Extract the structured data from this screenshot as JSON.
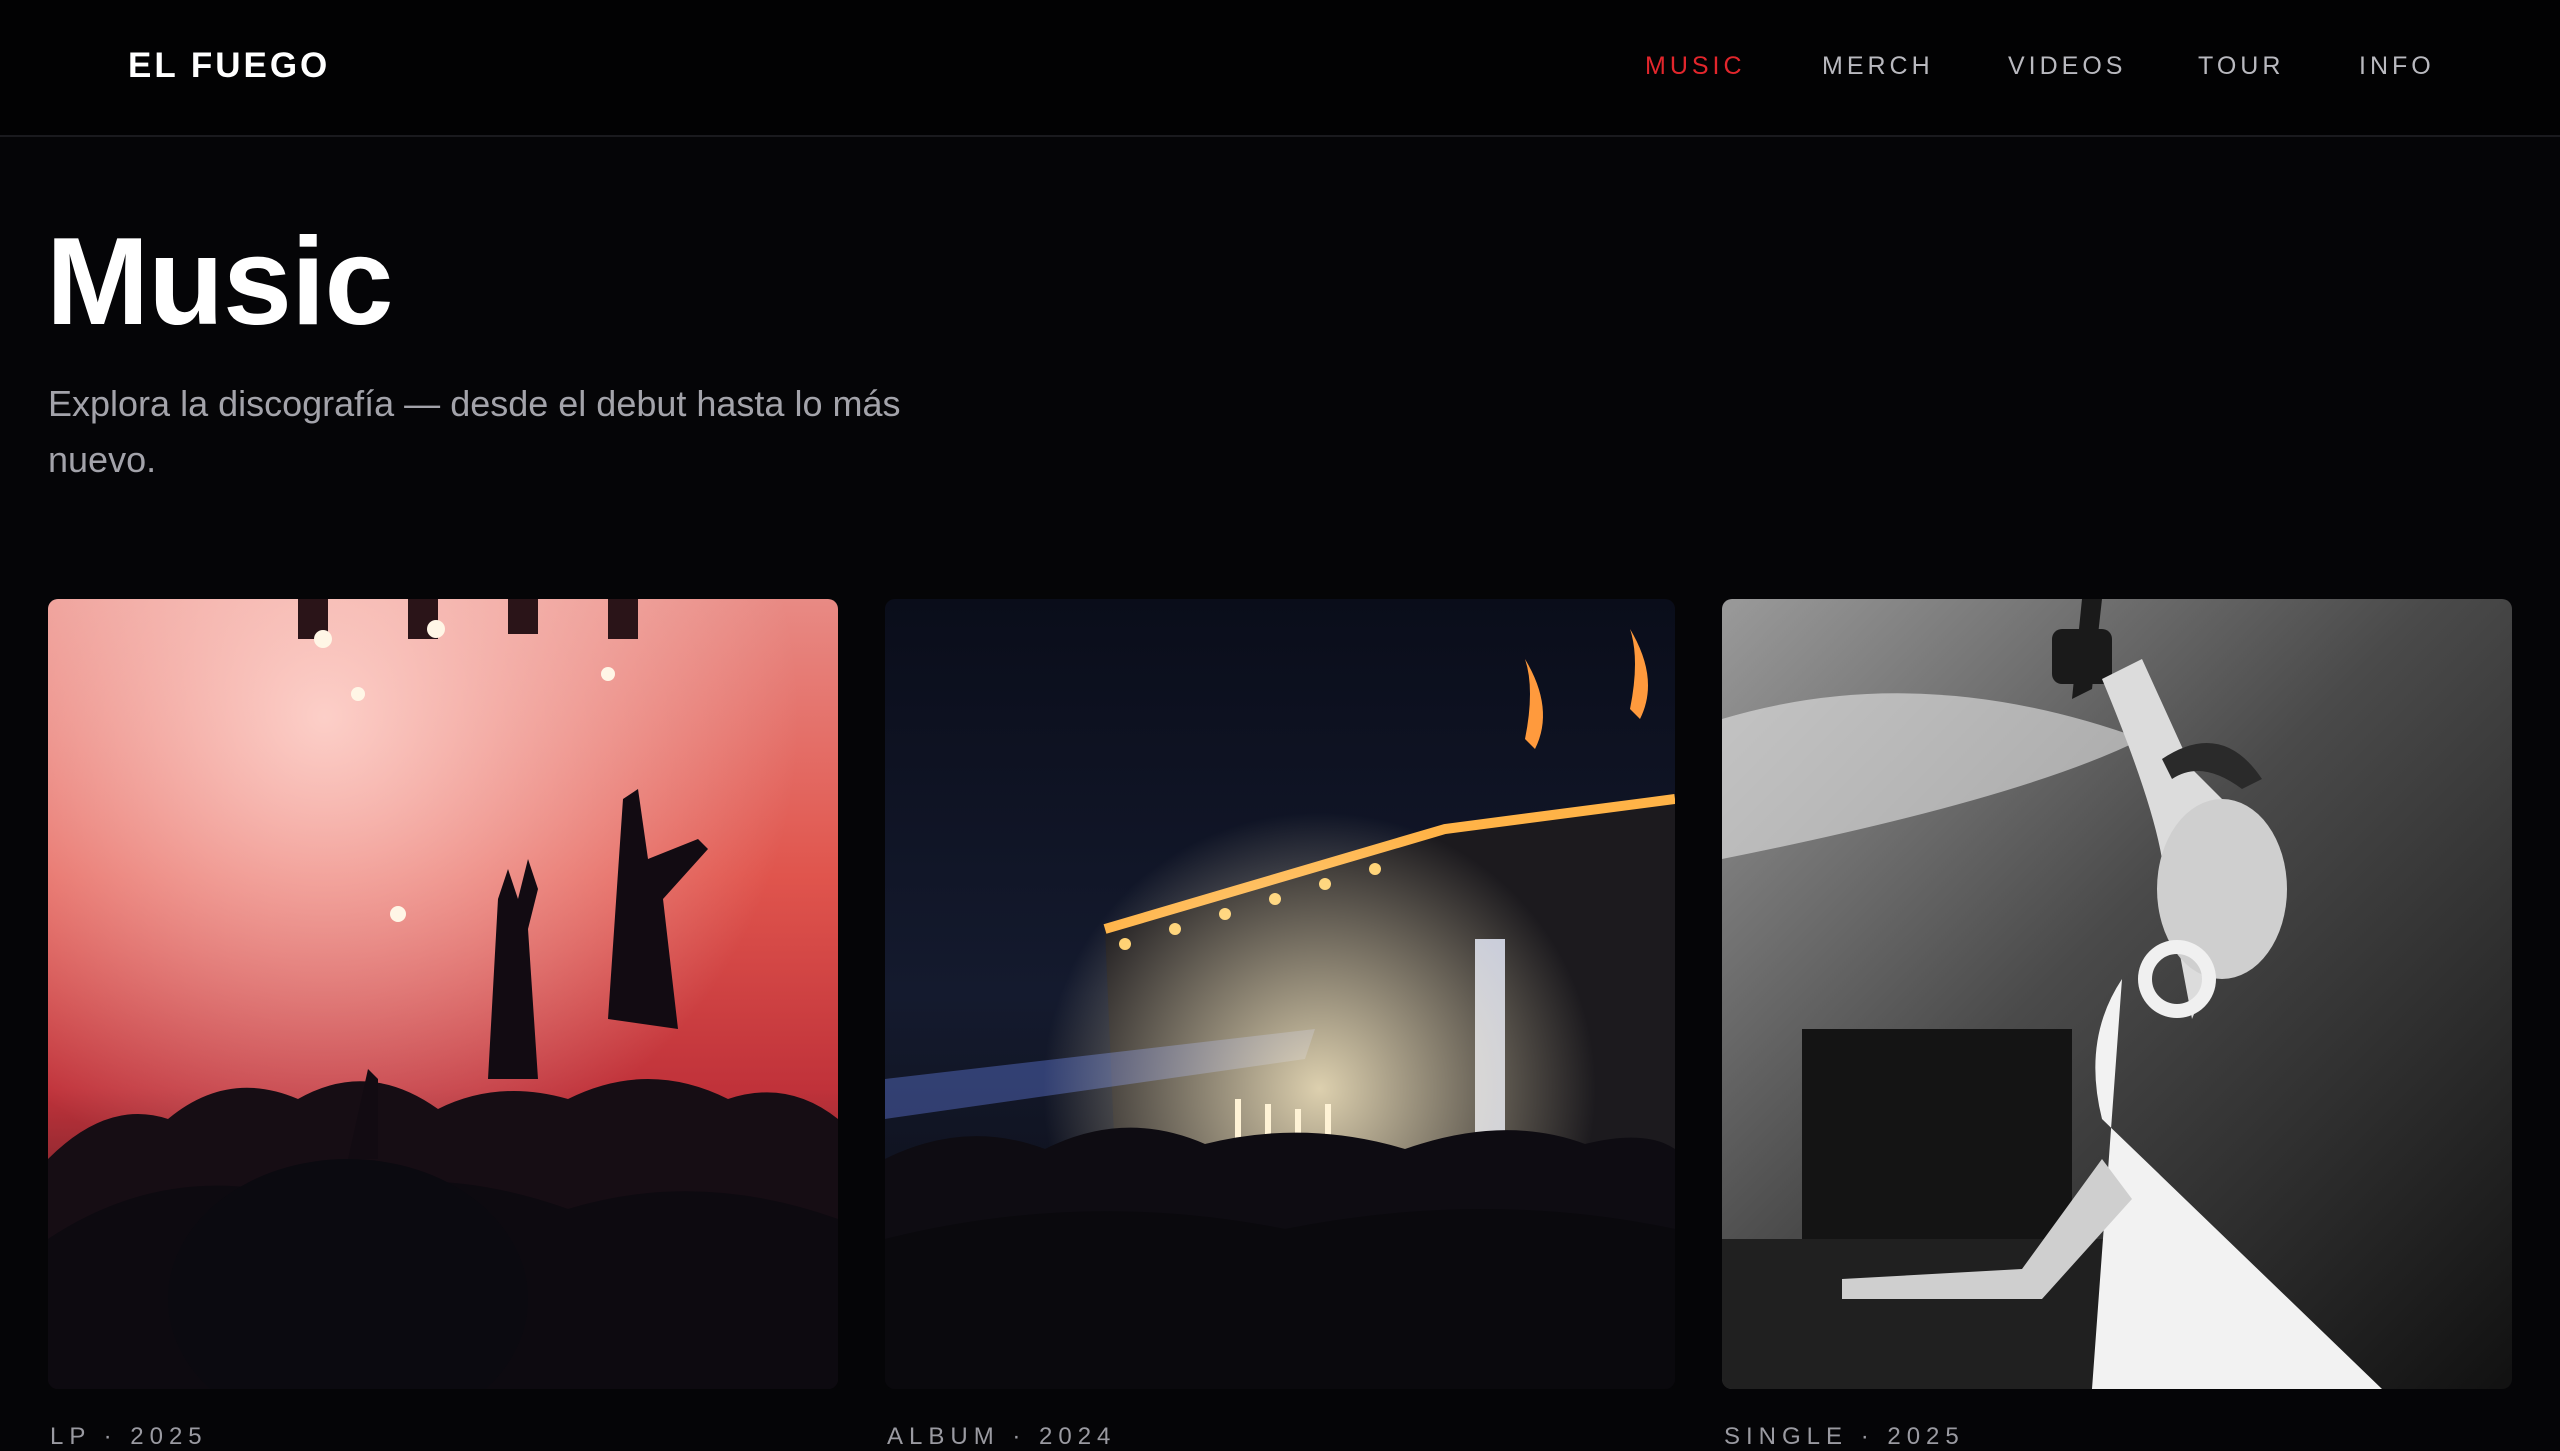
{
  "header": {
    "logo": "EL FUEGO",
    "nav": [
      {
        "label": "MUSIC",
        "active": true
      },
      {
        "label": "MERCH",
        "active": false
      },
      {
        "label": "VIDEOS",
        "active": false
      },
      {
        "label": "TOUR",
        "active": false
      },
      {
        "label": "INFO",
        "active": false
      }
    ]
  },
  "hero": {
    "title": "Music",
    "subtitle": "Explora la discografía — desde el debut hasta lo más nuevo."
  },
  "releases": [
    {
      "meta": "LP · 2025"
    },
    {
      "meta": "ALBUM · 2024"
    },
    {
      "meta": "SINGLE · 2025"
    }
  ],
  "colors": {
    "accent": "#e2262c",
    "background": "#050507",
    "nav_text": "#b9b9bf",
    "muted_text": "#a3a3aa"
  }
}
